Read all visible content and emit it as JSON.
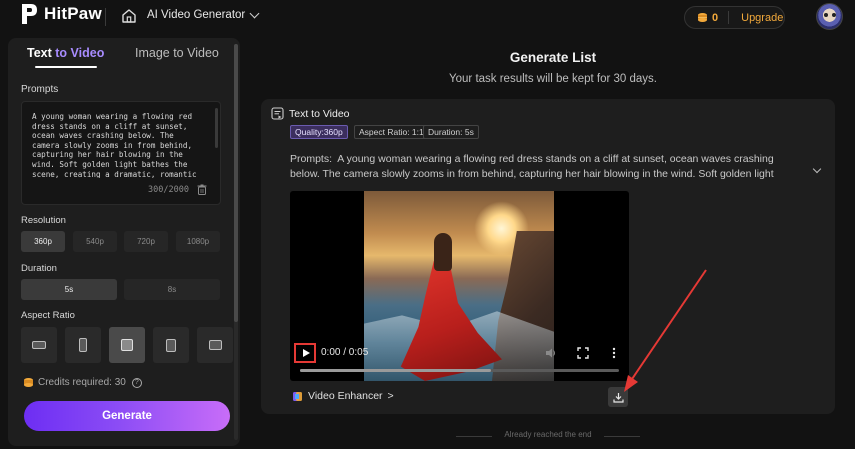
{
  "header": {
    "logo_text": "HitPaw",
    "app_name": "AI Video Generator",
    "credits": "0",
    "upgrade_label": "Upgrade"
  },
  "left_panel": {
    "tabs": [
      {
        "label_prefix": "Text ",
        "label_highlight": "to Video"
      },
      {
        "label": "Image to Video"
      }
    ],
    "prompts_label": "Prompts",
    "prompt_text": "A young woman wearing a flowing red dress stands on a cliff at sunset, ocean waves crashing below. The camera slowly zooms in from behind, capturing her hair blowing in the wind. Soft golden light bathes the scene, creating a dramatic, romantic atmosphere. Cinematic, realistic style. smooth",
    "prompt_count": "300/2000",
    "resolution_label": "Resolution",
    "resolutions": [
      "360p",
      "540p",
      "720p",
      "1080p"
    ],
    "duration_label": "Duration",
    "durations": [
      "5s",
      "8s"
    ],
    "aspect_ratio_label": "Aspect Ratio",
    "credits_required": "Credits required: 30",
    "generate_label": "Generate"
  },
  "main": {
    "title": "Generate List",
    "subtitle": "Your task results will be kept for 30 days.",
    "card": {
      "type_label": "Text to Video",
      "badges": [
        "Quality:360p",
        "Aspect Ratio: 1:1",
        "Duration: 5s"
      ],
      "prompt_label": "Prompts:",
      "prompt_text": "A young woman wearing a flowing red dress stands on a cliff at sunset, ocean waves crashing below. The camera slowly zooms in from behind, capturing her hair blowing in the wind. Soft golden light bathes the scene,...",
      "time": "0:00 / 0:05",
      "enhancer_label": "Video Enhancer",
      "enhancer_chevron": ">"
    },
    "end_text": "Already reached the end"
  },
  "colors": {
    "accent_purple": "#a88cff",
    "generate_gradient_start": "#6d2ef3",
    "generate_gradient_end": "#c86df8",
    "credit_orange": "#f2a93b",
    "annotation_red": "#e53935"
  }
}
